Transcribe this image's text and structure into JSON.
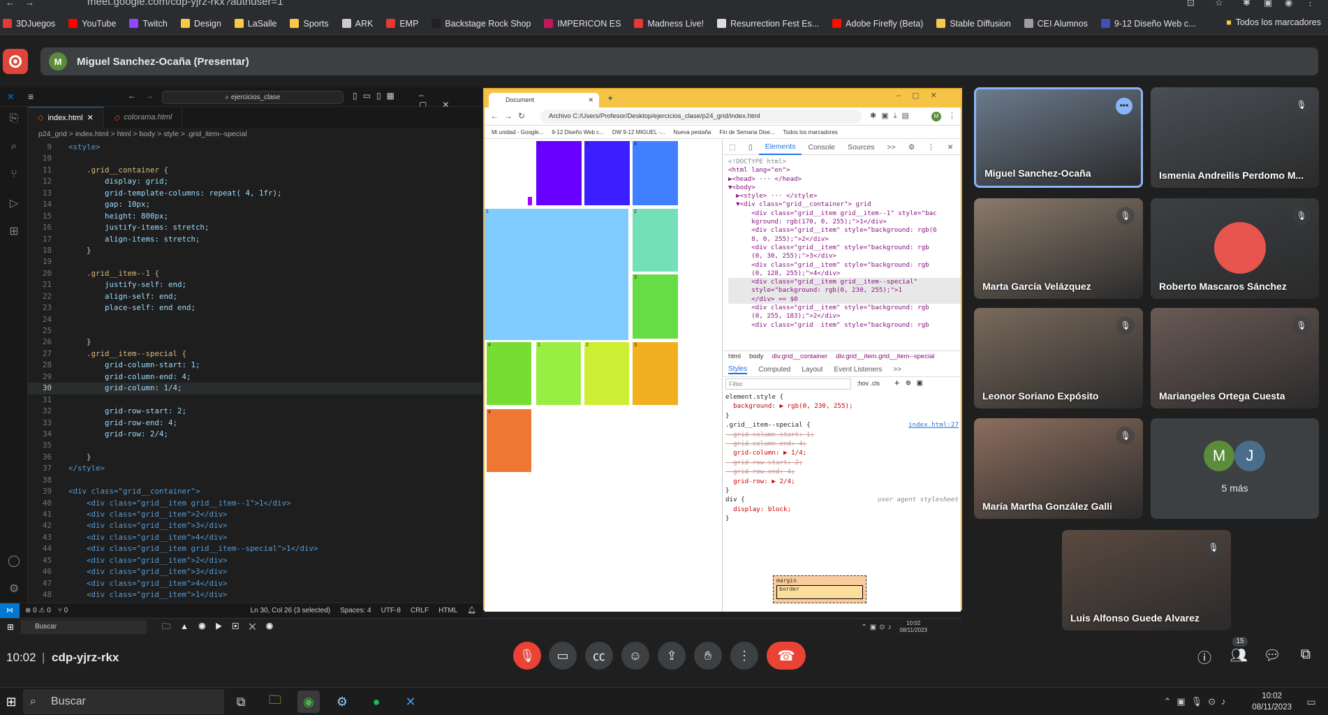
{
  "browser": {
    "url": "meet.google.com/cdp-yjrz-rkx?authuser=1",
    "bookmarks": [
      {
        "label": "3DJuegos",
        "color": "#e53935"
      },
      {
        "label": "YouTube",
        "color": "#ff0000"
      },
      {
        "label": "Twitch",
        "color": "#9146ff"
      },
      {
        "label": "Design",
        "color": "#f7c948"
      },
      {
        "label": "LaSalle",
        "color": "#f7c948"
      },
      {
        "label": "Sports",
        "color": "#f7c948"
      },
      {
        "label": "ARK",
        "color": "#cccccc"
      },
      {
        "label": "EMP",
        "color": "#e53935"
      },
      {
        "label": "Backstage Rock Shop",
        "color": "#222222"
      },
      {
        "label": "IMPERICON ES",
        "color": "#c2185b"
      },
      {
        "label": "Madness Live!",
        "color": "#e53935"
      },
      {
        "label": "Resurrection Fest Es...",
        "color": "#dddddd"
      },
      {
        "label": "Adobe Firefly (Beta)",
        "color": "#fa0f00"
      },
      {
        "label": "Stable Diffusion",
        "color": "#f7c948"
      },
      {
        "label": "CEI Alumnos",
        "color": "#9e9e9e"
      },
      {
        "label": "9-12 Diseño Web c...",
        "color": "#3f51b5"
      }
    ],
    "all_bookmarks": "Todos los marcadores"
  },
  "meet": {
    "presenter_initial": "M",
    "presenter_label": "Miguel Sanchez-Ocaña (Presentar)",
    "time": "10:02",
    "code": "cdp-yjrz-rkx",
    "participant_count": "15",
    "participants": [
      {
        "name": "Miguel Sanchez-Ocaña"
      },
      {
        "name": "Ismenia Andreilis Perdomo M..."
      },
      {
        "name": "Marta García Velázquez"
      },
      {
        "name": "Roberto Mascaros Sánchez"
      },
      {
        "name": "Leonor Soriano Expósito"
      },
      {
        "name": "Mariangeles Ortega Cuesta"
      },
      {
        "name": "María Martha González Galli"
      },
      {
        "name": "Luis Alfonso Guede Alvarez"
      }
    ],
    "more_label": "5 más",
    "more_initials": [
      "M",
      "J"
    ]
  },
  "vscode": {
    "search": "ejercicios_clase",
    "tabs": [
      {
        "label": "index.html"
      },
      {
        "label": "colorama.html"
      }
    ],
    "breadcrumb": "p24_grid > index.html > html > body > style > .grid_item--special",
    "status": {
      "errors": "⊗ 0 ⚠ 0",
      "ports": "⑂ 0",
      "position": "Ln 30, Col 26 (3 selected)",
      "spaces": "Spaces: 4",
      "encoding": "UTF-8",
      "eol": "CRLF",
      "lang": "HTML"
    },
    "lines": [
      {
        "n": "9",
        "t": "<style>"
      },
      {
        "n": "10",
        "t": ""
      },
      {
        "n": "11",
        "t": "    .grid__container {"
      },
      {
        "n": "12",
        "t": "        display: grid;"
      },
      {
        "n": "13",
        "t": "        grid-template-columns: repeat( 4, 1fr);"
      },
      {
        "n": "14",
        "t": "        gap: 10px;"
      },
      {
        "n": "15",
        "t": "        height: 800px;"
      },
      {
        "n": "16",
        "t": "        justify-items: stretch;"
      },
      {
        "n": "17",
        "t": "        align-items: stretch;"
      },
      {
        "n": "18",
        "t": "    }"
      },
      {
        "n": "19",
        "t": ""
      },
      {
        "n": "20",
        "t": "    .grid__item--1 {"
      },
      {
        "n": "21",
        "t": "        justify-self: end;"
      },
      {
        "n": "22",
        "t": "        align-self: end;"
      },
      {
        "n": "23",
        "t": "        place-self: end end;"
      },
      {
        "n": "24",
        "t": ""
      },
      {
        "n": "25",
        "t": ""
      },
      {
        "n": "26",
        "t": "    }"
      },
      {
        "n": "27",
        "t": "    .grid__item--special {"
      },
      {
        "n": "28",
        "t": "        grid-column-start: 1;"
      },
      {
        "n": "29",
        "t": "        grid-column-end: 4;"
      },
      {
        "n": "30",
        "t": "        grid-column: 1/4;"
      },
      {
        "n": "31",
        "t": ""
      },
      {
        "n": "32",
        "t": "        grid-row-start: 2;"
      },
      {
        "n": "33",
        "t": "        grid-row-end: 4;"
      },
      {
        "n": "34",
        "t": "        grid-row: 2/4;"
      },
      {
        "n": "35",
        "t": ""
      },
      {
        "n": "36",
        "t": "    }"
      },
      {
        "n": "37",
        "t": "</style>"
      },
      {
        "n": "38",
        "t": ""
      },
      {
        "n": "39",
        "t": "<div class=\"grid__container\">"
      },
      {
        "n": "40",
        "t": "    <div class=\"grid__item grid__item--1\">1</div>"
      },
      {
        "n": "41",
        "t": "    <div class=\"grid__item\">2</div>"
      },
      {
        "n": "42",
        "t": "    <div class=\"grid__item\">3</div>"
      },
      {
        "n": "43",
        "t": "    <div class=\"grid__item\">4</div>"
      },
      {
        "n": "44",
        "t": "    <div class=\"grid__item grid__item--special\">1</div>"
      },
      {
        "n": "45",
        "t": "    <div class=\"grid__item\">2</div>"
      },
      {
        "n": "46",
        "t": "    <div class=\"grid__item\">3</div>"
      },
      {
        "n": "47",
        "t": "    <div class=\"grid__item\">4</div>"
      },
      {
        "n": "48",
        "t": "    <div class=\"grid__item\">1</div>"
      }
    ]
  },
  "shared_browser": {
    "tab_title": "Document",
    "url": "Archivo  C:/Users/Profesor/Desktop/ejercicios_clase/p24_grid/index.html",
    "bookmarks": [
      "Mi unidad - Google...",
      "9-12 Diseño Web c...",
      "DW 9-12 MIGUEL -...",
      "Nueva pestaña",
      "Fin de Semana Dise...",
      "Todos los marcadores"
    ],
    "grid_items": [
      {
        "label": "",
        "color": "#aa00ff"
      },
      {
        "label": "2",
        "color": "#6800ff"
      },
      {
        "label": "3",
        "color": "#3c1eff"
      },
      {
        "label": "4",
        "color": "#4080ff"
      },
      {
        "label": "1",
        "color": "#80ccff"
      },
      {
        "label": "2",
        "color": "#73e0b8"
      },
      {
        "label": "3",
        "color": "#66dd44"
      },
      {
        "label": "4",
        "color": "#77dd33"
      },
      {
        "label": "1",
        "color": "#99ee44"
      },
      {
        "label": "2",
        "color": "#ccee33"
      },
      {
        "label": "3",
        "color": "#f0b020"
      },
      {
        "label": "4",
        "color": "#ee7733"
      }
    ],
    "devtools": {
      "tabs": [
        "Elements",
        "Console",
        "Sources",
        ">>"
      ],
      "dom": [
        "<!DOCTYPE html>",
        "<html lang=\"en\">",
        "▶<head> ··· </head>",
        "▼<body>",
        "  ▶<style> ··· </style>",
        "  ▼<div class=\"grid__container\"> grid",
        "      <div class=\"grid__item grid__item--1\" style=\"bac",
        "      kground: rgb(170, 0, 255);\">1</div>",
        "      <div class=\"grid__item\" style=\"background: rgb(6",
        "      8, 0, 255);\">2</div>",
        "      <div class=\"grid__item\" style=\"background: rgb",
        "      (0, 30, 255);\">3</div>",
        "      <div class=\"grid__item\" style=\"background: rgb",
        "      (0, 128, 255);\">4</div>",
        "      <div class=\"grid__item grid__item--special\"",
        "      style=\"background: rgb(0, 230, 255);\">1",
        "      </div> == $0",
        "      <div class=\"grid__item\" style=\"background: rgb",
        "      (0, 255, 183);\">2</div>",
        "      <div class=\"grid  item\" style=\"background: rgb"
      ],
      "crumbs": [
        "html",
        "body",
        "div.grid__container",
        "div.grid__item.grid__item--special"
      ],
      "style_tabs": [
        "Styles",
        "Computed",
        "Layout",
        "Event Listeners",
        ">>"
      ],
      "filter": "Filter",
      "hov": ":hov  .cls",
      "styles": {
        "element_style": "element.style {",
        "element_bg": "  background: ▶ rgb(0, 230, 255);",
        "rule_selector": ".grid__item--special {",
        "rule_source": "index.html:27",
        "rule_lines": [
          {
            "t": "  grid-column-start: 1;",
            "s": true
          },
          {
            "t": "  grid-column-end: 4;",
            "s": true
          },
          {
            "t": "  grid-column: ▶ 1/4;",
            "s": false
          },
          {
            "t": "  grid-row-start: 2;",
            "s": true
          },
          {
            "t": "  grid-row-end: 4;",
            "s": true
          },
          {
            "t": "  grid-row: ▶ 2/4;",
            "s": false
          }
        ],
        "div_rule": "div {",
        "ua_label": "user agent stylesheet",
        "div_display": "  display: block;",
        "close": "}",
        "box_margin": "margin",
        "box_border": "border"
      }
    }
  },
  "taskbar_inner": {
    "search": "Buscar",
    "time": "10:02",
    "date": "08/11/2023"
  },
  "taskbar": {
    "search": "Buscar",
    "time": "10:02",
    "date": "08/11/2023"
  }
}
